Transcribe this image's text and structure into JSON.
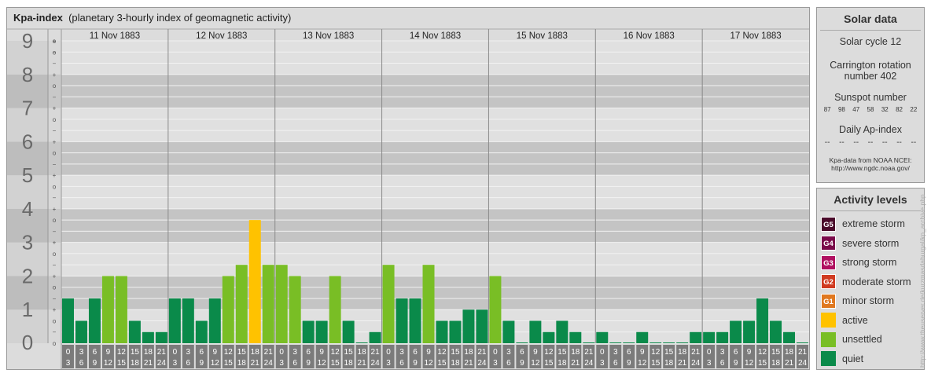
{
  "header": {
    "title": "Kpa-index",
    "subtitle": "(planetary 3-hourly index of geomagnetic activity)"
  },
  "chart_data": {
    "type": "bar",
    "days": [
      "11 Nov 1883",
      "12 Nov 1883",
      "13 Nov 1883",
      "14 Nov 1883",
      "15 Nov 1883",
      "16 Nov 1883",
      "17 Nov 1883"
    ],
    "y_levels": [
      "0",
      "1",
      "2",
      "3",
      "4",
      "5",
      "6",
      "7",
      "8",
      "9"
    ],
    "sub_levels": [
      "+",
      "o",
      "−"
    ],
    "x_interval_starts": [
      "0",
      "3",
      "6",
      "9",
      "12",
      "15",
      "18",
      "21"
    ],
    "x_interval_ends": [
      "3",
      "6",
      "9",
      "12",
      "15",
      "18",
      "21",
      "24"
    ],
    "ylim": [
      0,
      9
    ],
    "values": [
      1.333,
      0.667,
      1.333,
      2.0,
      2.0,
      0.667,
      0.333,
      0.333,
      1.333,
      1.333,
      0.667,
      1.333,
      2.0,
      2.333,
      3.667,
      2.333,
      2.333,
      2.0,
      0.667,
      0.667,
      2.0,
      0.667,
      0.0,
      0.333,
      2.333,
      1.333,
      1.333,
      2.333,
      0.667,
      0.667,
      1.0,
      1.0,
      2.0,
      0.667,
      0.0,
      0.667,
      0.333,
      0.667,
      0.333,
      0.0,
      0.333,
      0.0,
      0.0,
      0.333,
      0.0,
      0.0,
      0.0,
      0.333,
      0.333,
      0.333,
      0.667,
      0.667,
      1.333,
      0.667,
      0.333,
      0.0
    ],
    "bar_colors": {
      "quiet": "#0a8a4a",
      "unsettled": "#79be25",
      "active": "#ffc200"
    },
    "grid": true
  },
  "solar": {
    "title": "Solar data",
    "cycle": "Solar cycle 12",
    "carrington_line1": "Carrington rotation",
    "carrington_line2": "number 402",
    "sunspot_label": "Sunspot number",
    "sunspots": [
      "87",
      "98",
      "47",
      "58",
      "32",
      "82",
      "22"
    ],
    "ap_label": "Daily Ap-index",
    "ap_values": [
      "--",
      "--",
      "--",
      "--",
      "--",
      "--",
      "--"
    ],
    "source_line1": "Kpa-data from NOAA NCEI:",
    "source_line2": "http://www.ngdc.noaa.gov/"
  },
  "activity": {
    "title": "Activity levels",
    "levels": [
      {
        "code": "G5",
        "label": "extreme storm",
        "color": "#4a0a2a"
      },
      {
        "code": "G4",
        "label": "severe storm",
        "color": "#7a0a4a"
      },
      {
        "code": "G3",
        "label": "strong storm",
        "color": "#b01060"
      },
      {
        "code": "G2",
        "label": "moderate storm",
        "color": "#d03a20"
      },
      {
        "code": "G1",
        "label": "minor storm",
        "color": "#e07820"
      },
      {
        "code": "",
        "label": "active",
        "color": "#ffc200"
      },
      {
        "code": "",
        "label": "unsettled",
        "color": "#79be25"
      },
      {
        "code": "",
        "label": "quiet",
        "color": "#0a8a4a"
      }
    ]
  },
  "credit": "http://www.theuserver.de/kurzmasdaburgal/kp_archive.php"
}
